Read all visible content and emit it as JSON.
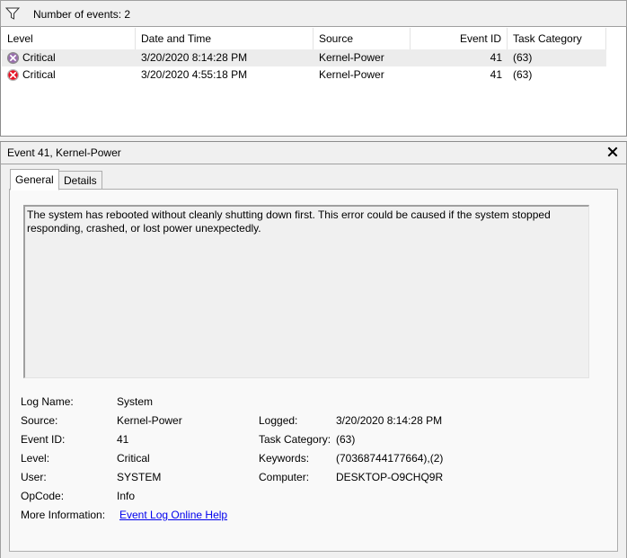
{
  "filter_bar": {
    "icon": "filter-icon",
    "label": "Number of events: 2"
  },
  "events_table": {
    "columns": [
      "Level",
      "Date and Time",
      "Source",
      "Event ID",
      "Task Category"
    ],
    "rows": [
      {
        "level": "Critical",
        "datetime": "3/20/2020 8:14:28 PM",
        "source": "Kernel-Power",
        "event_id": "41",
        "task_category": "(63)",
        "selected": true
      },
      {
        "level": "Critical",
        "datetime": "3/20/2020 4:55:18 PM",
        "source": "Kernel-Power",
        "event_id": "41",
        "task_category": "(63)",
        "selected": false
      }
    ]
  },
  "details": {
    "title": "Event 41, Kernel-Power",
    "tabs": [
      "General",
      "Details"
    ],
    "active_tab": "General",
    "description": "The system has rebooted without cleanly shutting down first. This error could be caused if the system stopped responding, crashed, or lost power unexpectedly.",
    "fields": {
      "log_name_label": "Log Name:",
      "log_name": "System",
      "source_label": "Source:",
      "source": "Kernel-Power",
      "logged_label": "Logged:",
      "logged": "3/20/2020 8:14:28 PM",
      "event_id_label": "Event ID:",
      "event_id": "41",
      "task_category_label": "Task Category:",
      "task_category": "(63)",
      "level_label": "Level:",
      "level": "Critical",
      "keywords_label": "Keywords:",
      "keywords": "(70368744177664),(2)",
      "user_label": "User:",
      "user": "SYSTEM",
      "computer_label": "Computer:",
      "computer": "DESKTOP-O9CHQ9R",
      "opcode_label": "OpCode:",
      "opcode": "Info",
      "more_info_label": "More Information:",
      "more_info_link": "Event Log Online Help"
    }
  },
  "colors": {
    "critical_icon": "#e81123",
    "link": "#0000ee",
    "selected_row": "#ececec"
  }
}
